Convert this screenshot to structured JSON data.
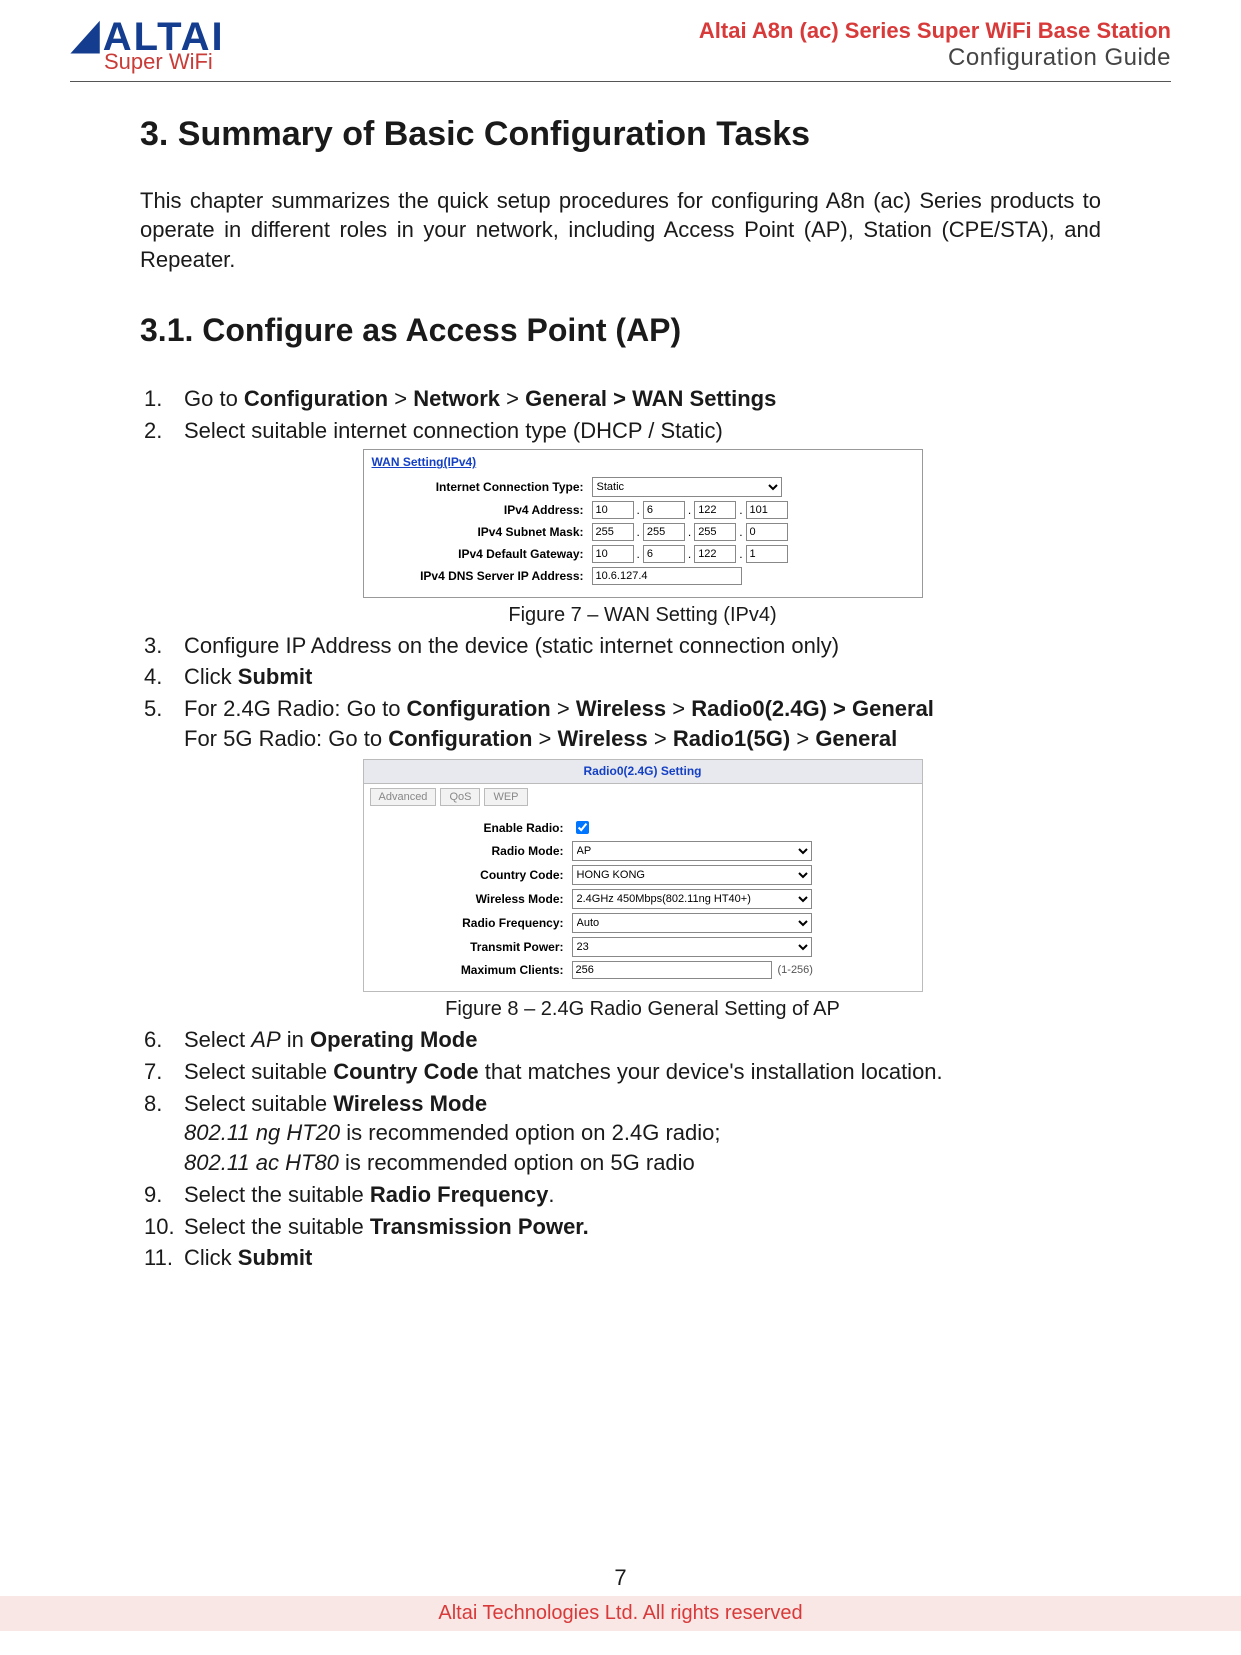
{
  "header": {
    "logo_top": "ALTAI",
    "logo_sub": "Super WiFi",
    "line1": "Altai A8n (ac) Series Super WiFi Base Station",
    "line2": "Configuration Guide"
  },
  "section": {
    "title": "3. Summary of Basic Configuration Tasks",
    "intro": "This chapter summarizes the quick setup procedures for configuring A8n (ac) Series products to operate in different roles in your network, including Access Point (AP), Station (CPE/STA), and Repeater.",
    "subtitle": "3.1. Configure as Access Point (AP)"
  },
  "steps": {
    "s1_pre": "Go to ",
    "s1_b": "Configuration",
    "s1_gt1": " > ",
    "s1_b2": "Network",
    "s1_gt2": " > ",
    "s1_b3": "General > WAN Settings",
    "s2": "Select suitable internet connection type (DHCP / Static)",
    "s3": "Configure IP Address on the device (static internet connection only)",
    "s4_pre": "Click ",
    "s4_b": "Submit",
    "s5_a_pre": "For 2.4G Radio: Go to ",
    "s5_a_b1": "Configuration",
    "s5_a_gt1": " > ",
    "s5_a_b2": "Wireless",
    "s5_a_gt2": " > ",
    "s5_a_b3": "Radio0(2.4G) > General",
    "s5_b_pre": "For 5G Radio: Go to ",
    "s5_b_b1": "Configuration",
    "s5_b_gt1": " > ",
    "s5_b_b2": "Wireless",
    "s5_b_gt2": " > ",
    "s5_b_b3": "Radio1(5G)",
    "s5_b_gt3": " > ",
    "s5_b_b4": "General",
    "s6_pre": "Select ",
    "s6_i": "AP",
    "s6_mid": " in ",
    "s6_b": "Operating Mode",
    "s7_pre": "Select suitable ",
    "s7_b": "Country Code",
    "s7_post": " that matches your device's installation location.",
    "s8_pre": "Select suitable ",
    "s8_b": "Wireless Mode",
    "s8_l1_i": "802.11 ng HT20",
    "s8_l1_t": " is recommended option on 2.4G radio;",
    "s8_l2_i": "802.11 ac HT80",
    "s8_l2_t": " is recommended option on 5G radio",
    "s9_pre": "Select the suitable ",
    "s9_b": "Radio Frequency",
    "s9_post": ".",
    "s10_pre": "Select the suitable ",
    "s10_b": "Transmission Power.",
    "s11_pre": "Click ",
    "s11_b": "Submit"
  },
  "fig7": {
    "caption": "Figure 7 – WAN Setting (IPv4)",
    "title": "WAN Setting(IPv4)",
    "labels": {
      "conn": "Internet Connection Type:",
      "addr": "IPv4 Address:",
      "mask": "IPv4 Subnet Mask:",
      "gw": "IPv4 Default Gateway:",
      "dns": "IPv4 DNS Server IP Address:"
    },
    "conn_type": "Static",
    "addr": [
      "10",
      "6",
      "122",
      "101"
    ],
    "mask": [
      "255",
      "255",
      "255",
      "0"
    ],
    "gw": [
      "10",
      "6",
      "122",
      "1"
    ],
    "dns": "10.6.127.4"
  },
  "fig8": {
    "caption": "Figure 8 – 2.4G Radio General Setting of AP",
    "bar": "Radio0(2.4G) Setting",
    "tabs": [
      "Advanced",
      "QoS",
      "WEP"
    ],
    "labels": {
      "enable": "Enable Radio:",
      "mode": "Radio Mode:",
      "country": "Country Code:",
      "wmode": "Wireless Mode:",
      "freq": "Radio Frequency:",
      "tx": "Transmit Power:",
      "max": "Maximum Clients:"
    },
    "mode": "AP",
    "country": "HONG KONG",
    "wmode": "2.4GHz 450Mbps(802.11ng HT40+)",
    "freq": "Auto",
    "tx": "23",
    "max": "256",
    "max_hint": "(1-256)"
  },
  "footer": {
    "page": "7",
    "legal": "Altai Technologies Ltd. All rights reserved"
  }
}
